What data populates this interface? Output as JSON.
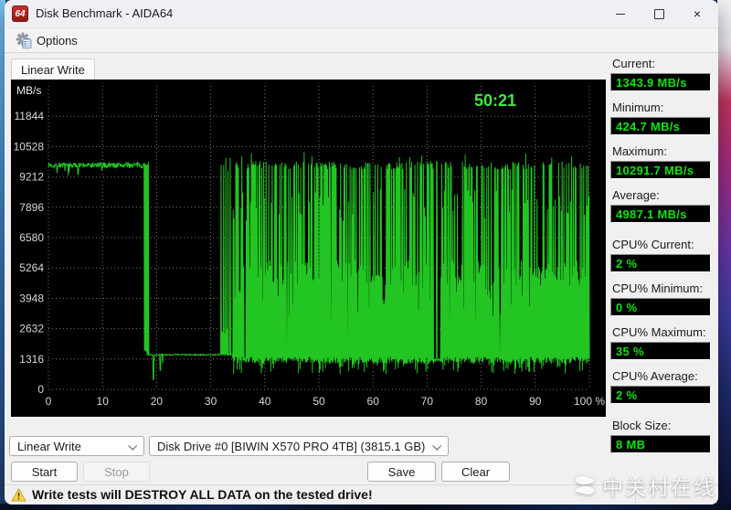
{
  "window": {
    "title": "Disk Benchmark - AIDA64",
    "icon_text": "64"
  },
  "menu": {
    "options_label": "Options"
  },
  "tabs": [
    {
      "label": "Linear Write"
    }
  ],
  "chart_data": {
    "type": "line",
    "unit": "MB/s",
    "timer": "50:21",
    "y_ticks": [
      0,
      1316,
      2632,
      3948,
      5264,
      6580,
      7896,
      9212,
      10528,
      11844
    ],
    "y_max": 13160,
    "x_ticks": [
      0,
      10,
      20,
      30,
      40,
      50,
      60,
      70,
      80,
      90,
      100
    ],
    "x_unit": "%",
    "grid": true,
    "line_color": "#22c522",
    "timer_color": "#41e941",
    "label_color": "#d8d8d8",
    "grid_color": "#787878",
    "seed": 7,
    "segments": [
      {
        "from": 0,
        "to": 17.7,
        "mode": "noisy_flat",
        "base": 9720,
        "noise": 240
      },
      {
        "from": 17.7,
        "to": 18.55,
        "mode": "collapse",
        "high": 9650,
        "low": 1550
      },
      {
        "from": 18.55,
        "to": 31.9,
        "mode": "noisy_flat",
        "base": 1500,
        "noise": 50,
        "dips": [
          {
            "x": 19.3,
            "w": 0.15,
            "v": 424.7
          },
          {
            "x": 20.6,
            "w": 0.13,
            "v": 820
          },
          {
            "x": 21.05,
            "w": 0.08,
            "v": 1120
          }
        ]
      },
      {
        "from": 31.9,
        "to": 34.0,
        "mode": "sparse_spikes",
        "base": 1500,
        "spike_top": 9600,
        "period": 0.42
      },
      {
        "from": 34.0,
        "to": 100,
        "mode": "dense_burst",
        "low": 1250,
        "low_dip": 650,
        "mid": 5000,
        "high": 9700,
        "max_peak": 10291.7,
        "gap": {
          "from": 71.25,
          "to": 72.4,
          "spike_at": 71.75,
          "spike_v": 9870
        },
        "slots": [
          [
            36.1,
            36.45
          ],
          [
            44.0,
            44.22
          ],
          [
            55.2,
            55.42
          ],
          [
            83.3,
            83.5
          ]
        ]
      }
    ]
  },
  "stats": [
    {
      "label": "Current:",
      "value": "1343.9 MB/s"
    },
    {
      "label": "Minimum:",
      "value": "424.7 MB/s"
    },
    {
      "label": "Maximum:",
      "value": "10291.7 MB/s"
    },
    {
      "label": "Average:",
      "value": "4987.1 MB/s"
    },
    {
      "label": "CPU% Current:",
      "value": "2 %"
    },
    {
      "label": "CPU% Minimum:",
      "value": "0 %"
    },
    {
      "label": "CPU% Maximum:",
      "value": "35 %"
    },
    {
      "label": "CPU% Average:",
      "value": "2 %"
    },
    {
      "label": "Block Size:",
      "value": "8 MB"
    }
  ],
  "controls": {
    "test_type_select": {
      "value": "Linear Write"
    },
    "drive_select": {
      "value": "Disk Drive #0  [BIWIN X570 PRO 4TB]  (3815.1 GB)"
    },
    "start_label": "Start",
    "stop_label": "Stop",
    "save_label": "Save",
    "clear_label": "Clear"
  },
  "status_bar": {
    "warning": "Write tests will DESTROY ALL DATA on the tested drive!"
  },
  "watermark": {
    "text": "中关村在线"
  }
}
